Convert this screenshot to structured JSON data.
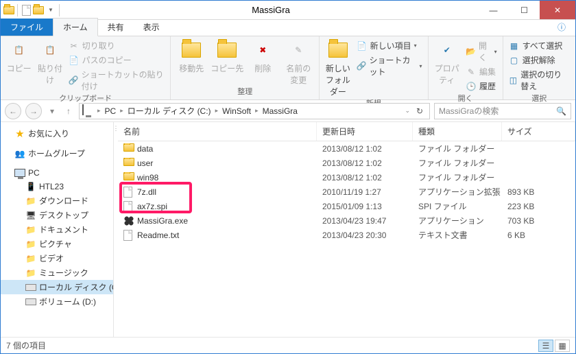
{
  "window": {
    "title": "MassiGra"
  },
  "tabs": {
    "file": "ファイル",
    "home": "ホーム",
    "share": "共有",
    "view": "表示"
  },
  "ribbon": {
    "clipboard": {
      "label": "クリップボード",
      "copy": "コピー",
      "paste": "貼り付け",
      "cut": "切り取り",
      "copy_path": "パスのコピー",
      "paste_shortcut": "ショートカットの貼り付け"
    },
    "organize": {
      "label": "整理",
      "move_to": "移動先",
      "copy_to": "コピー先",
      "delete": "削除",
      "rename": "名前の\n変更"
    },
    "new": {
      "label": "新規",
      "new_folder": "新しい\nフォルダー",
      "new_item": "新しい項目",
      "shortcut": "ショートカット"
    },
    "open": {
      "label": "開く",
      "properties": "プロパティ",
      "open": "開く",
      "edit": "編集",
      "history": "履歴"
    },
    "select": {
      "label": "選択",
      "select_all": "すべて選択",
      "select_none": "選択解除",
      "invert": "選択の切り替え"
    }
  },
  "breadcrumb": [
    "PC",
    "ローカル ディスク (C:)",
    "WinSoft",
    "MassiGra"
  ],
  "search": {
    "placeholder": "MassiGraの検索"
  },
  "columns": {
    "name": "名前",
    "date": "更新日時",
    "type": "種類",
    "size": "サイズ"
  },
  "files": [
    {
      "icon": "folder",
      "name": "data",
      "date": "2013/08/12 1:02",
      "type": "ファイル フォルダー",
      "size": ""
    },
    {
      "icon": "folder",
      "name": "user",
      "date": "2013/08/12 1:02",
      "type": "ファイル フォルダー",
      "size": ""
    },
    {
      "icon": "folder",
      "name": "win98",
      "date": "2013/08/12 1:02",
      "type": "ファイル フォルダー",
      "size": ""
    },
    {
      "icon": "dll",
      "name": "7z.dll",
      "date": "2010/11/19 1:27",
      "type": "アプリケーション拡張",
      "size": "893 KB"
    },
    {
      "icon": "file",
      "name": "ax7z.spi",
      "date": "2015/01/09 1:13",
      "type": "SPI ファイル",
      "size": "223 KB"
    },
    {
      "icon": "exe",
      "name": "MassiGra.exe",
      "date": "2013/04/23 19:47",
      "type": "アプリケーション",
      "size": "703 KB"
    },
    {
      "icon": "txt",
      "name": "Readme.txt",
      "date": "2013/04/23 20:30",
      "type": "テキスト文書",
      "size": "6 KB"
    }
  ],
  "nav": {
    "favorites": "お気に入り",
    "homegroup": "ホームグループ",
    "pc": "PC",
    "items": [
      "HTL23",
      "ダウンロード",
      "デスクトップ",
      "ドキュメント",
      "ピクチャ",
      "ビデオ",
      "ミュージック",
      "ローカル ディスク (C:)",
      "ボリューム (D:)"
    ]
  },
  "status": {
    "count": "7 個の項目"
  },
  "highlight": {
    "top_row": 3,
    "rows": 2
  }
}
